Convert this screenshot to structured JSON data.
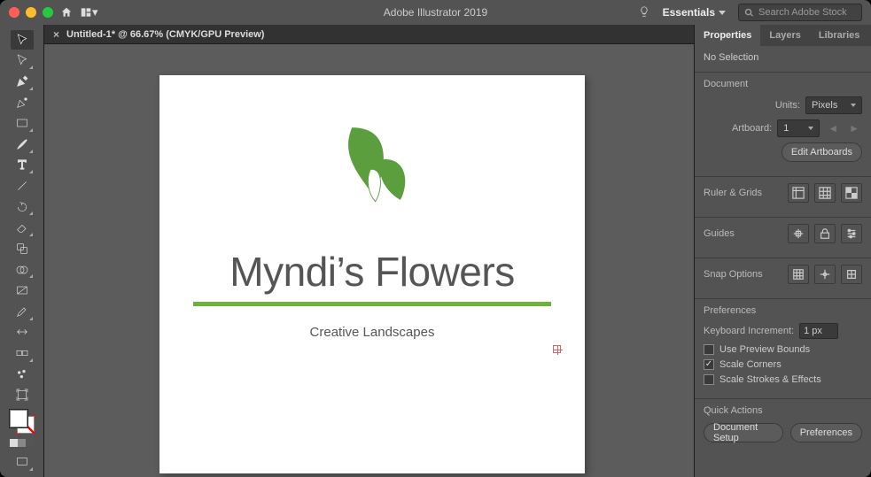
{
  "app_title": "Adobe Illustrator 2019",
  "workspace": "Essentials",
  "search_placeholder": "Search Adobe Stock",
  "doc_tab": "Untitled-1* @ 66.67% (CMYK/GPU Preview)",
  "artboard_content": {
    "headline": "Myndi’s Flowers",
    "subheadline": "Creative Landscapes"
  },
  "panel": {
    "tabs": {
      "properties": "Properties",
      "layers": "Layers",
      "libraries": "Libraries"
    },
    "selection_state": "No Selection",
    "document": {
      "title": "Document",
      "units_label": "Units:",
      "units_value": "Pixels",
      "artboard_label": "Artboard:",
      "artboard_value": "1",
      "edit_artboards": "Edit Artboards"
    },
    "ruler_grids": "Ruler & Grids",
    "guides": "Guides",
    "snap_options": "Snap Options",
    "preferences": {
      "title": "Preferences",
      "keyboard_increment_label": "Keyboard Increment:",
      "keyboard_increment_value": "1 px",
      "use_preview_bounds": "Use Preview Bounds",
      "scale_corners": "Scale Corners",
      "scale_strokes_effects": "Scale Strokes & Effects"
    },
    "quick_actions": {
      "title": "Quick Actions",
      "document_setup": "Document Setup",
      "preferences_btn": "Preferences"
    }
  }
}
